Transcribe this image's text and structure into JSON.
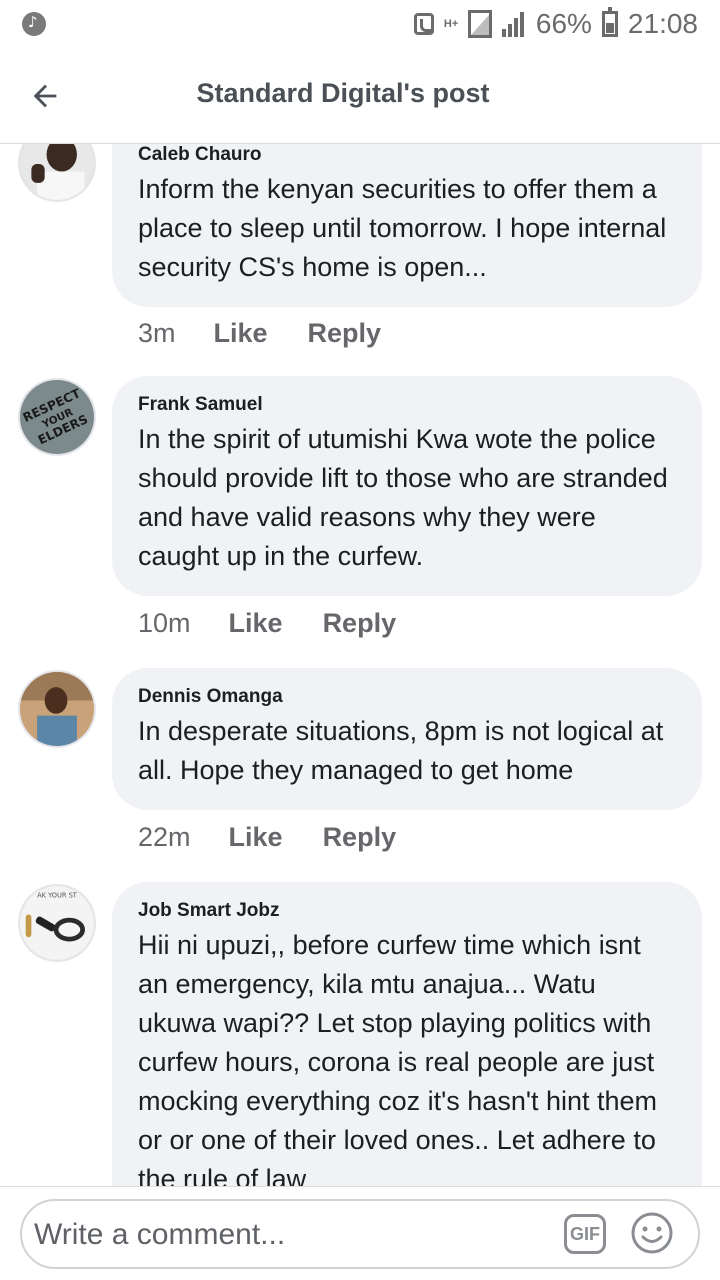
{
  "status_bar": {
    "battery": "66%",
    "time": "21:08",
    "network": "H+"
  },
  "header": {
    "title": "Standard Digital's post"
  },
  "comments": [
    {
      "author": "Caleb Chauro",
      "text": "Inform the kenyan securities to offer them a place to sleep until tomorrow. I hope internal security CS's home is open...",
      "time": "3m",
      "like": "Like",
      "reply": "Reply"
    },
    {
      "author": "Frank Samuel",
      "text": "In the spirit of utumishi Kwa wote the police should provide lift to those who are stranded and have valid reasons why they were caught up in the curfew.",
      "time": "10m",
      "like": "Like",
      "reply": "Reply",
      "avatar_text": "RESPECT YOUR ELDERS"
    },
    {
      "author": "Dennis Omanga",
      "text": "In desperate situations, 8pm is not logical at all. Hope they managed to get home",
      "time": "22m",
      "like": "Like",
      "reply": "Reply"
    },
    {
      "author": "Job Smart Jobz",
      "text": "Hii ni upuzi,, before curfew time which isnt an emergency, kila mtu anajua... Watu ukuwa wapi?? Let stop playing politics with curfew hours, corona is real people are just mocking everything coz it's hasn't hint them or or one of their loved ones.. Let adhere to the rule of law",
      "avatar_text": "AK YOUR ST"
    }
  ],
  "composer": {
    "placeholder": "Write a comment...",
    "gif_label": "GIF"
  },
  "colors": {
    "bubble": "#f0f2f5",
    "secondary_text": "#65676b",
    "title": "#4b4f56"
  }
}
